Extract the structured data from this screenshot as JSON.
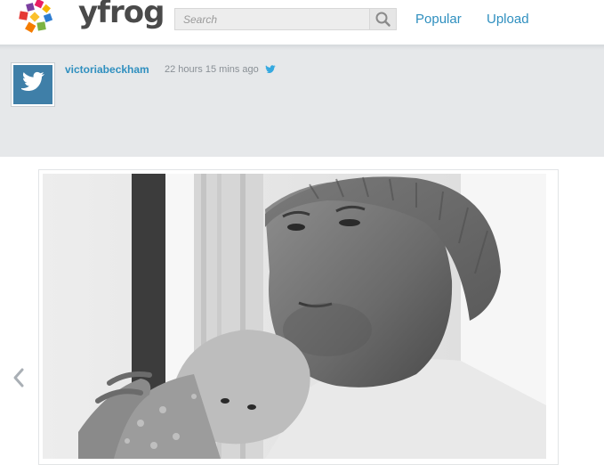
{
  "header": {
    "logo_text": "yfrog",
    "search_placeholder": "Search",
    "nav": [
      {
        "label": "Popular"
      },
      {
        "label": "Upload"
      }
    ]
  },
  "post": {
    "username": "victoriabeckham",
    "time_ago": "22 hours 15 mins ago",
    "source_icon": "twitter-bird-icon"
  },
  "colors": {
    "link_blue": "#2f8fbf",
    "band_gray": "#e6e8ea",
    "avatar_blue": "#3f7fa8"
  }
}
